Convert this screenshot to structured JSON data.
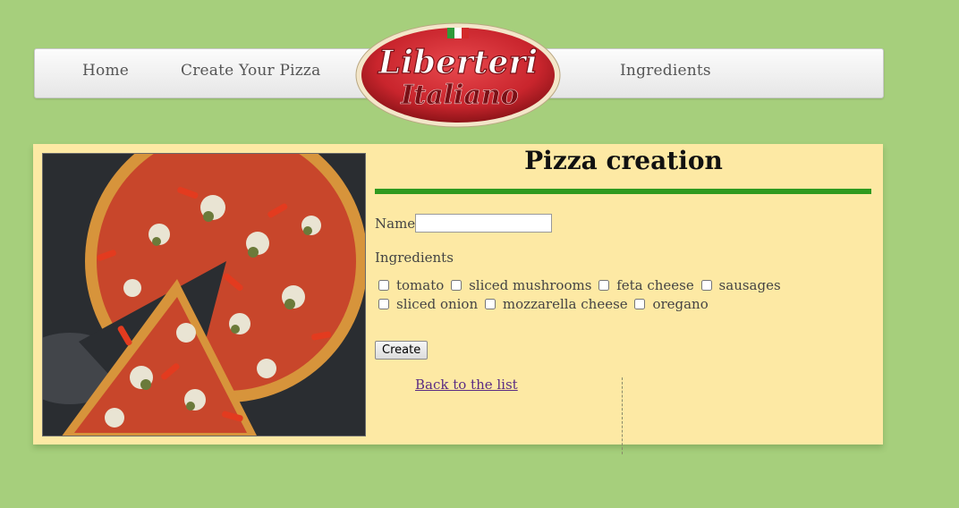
{
  "nav": {
    "home": "Home",
    "create": "Create Your Pizza",
    "ingredients": "Ingredients"
  },
  "logo": {
    "line1": "Liberteri",
    "line2": "Italiano",
    "flag_colors": [
      "#2e9b3a",
      "#ffffff",
      "#d32a2a"
    ],
    "colors": {
      "oval": "#c9252d",
      "text": "#ffffff",
      "text_outline": "#7a1016"
    }
  },
  "main": {
    "title": "Pizza creation",
    "name_label": "Name",
    "name_value": "",
    "ingredients_label": "Ingredients",
    "ingredients": [
      {
        "label": "tomato",
        "checked": false
      },
      {
        "label": "sliced mushrooms",
        "checked": false
      },
      {
        "label": "feta cheese",
        "checked": false
      },
      {
        "label": "sausages",
        "checked": false
      },
      {
        "label": "sliced onion",
        "checked": false
      },
      {
        "label": "mozzarella cheese",
        "checked": false
      },
      {
        "label": "oregano",
        "checked": false
      }
    ],
    "create_button": "Create",
    "back_link": "Back to the list"
  },
  "colors": {
    "page_bg": "#a6cf7c",
    "panel_bg": "#fde9a4",
    "accent_rule": "#2f9a1f",
    "link": "#5b2c83"
  }
}
